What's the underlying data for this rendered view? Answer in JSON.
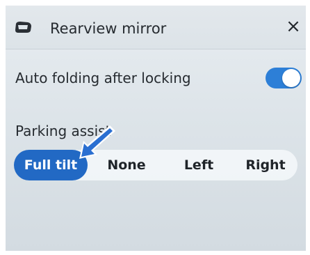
{
  "header": {
    "icon": "mirror-icon",
    "title": "Rearview mirror",
    "close_icon": "close-icon",
    "close_glyph": "×"
  },
  "auto_folding": {
    "label": "Auto folding after locking",
    "enabled": true
  },
  "parking_assist": {
    "label": "Parking assist",
    "options": [
      {
        "label": "Full tilt"
      },
      {
        "label": "None"
      },
      {
        "label": "Left"
      },
      {
        "label": "Right"
      }
    ],
    "selected": "Full tilt"
  },
  "colors": {
    "accent": "#2269c4",
    "toggle_on": "#2d7fd7",
    "pointer_arrow": "#2a6fd1"
  }
}
